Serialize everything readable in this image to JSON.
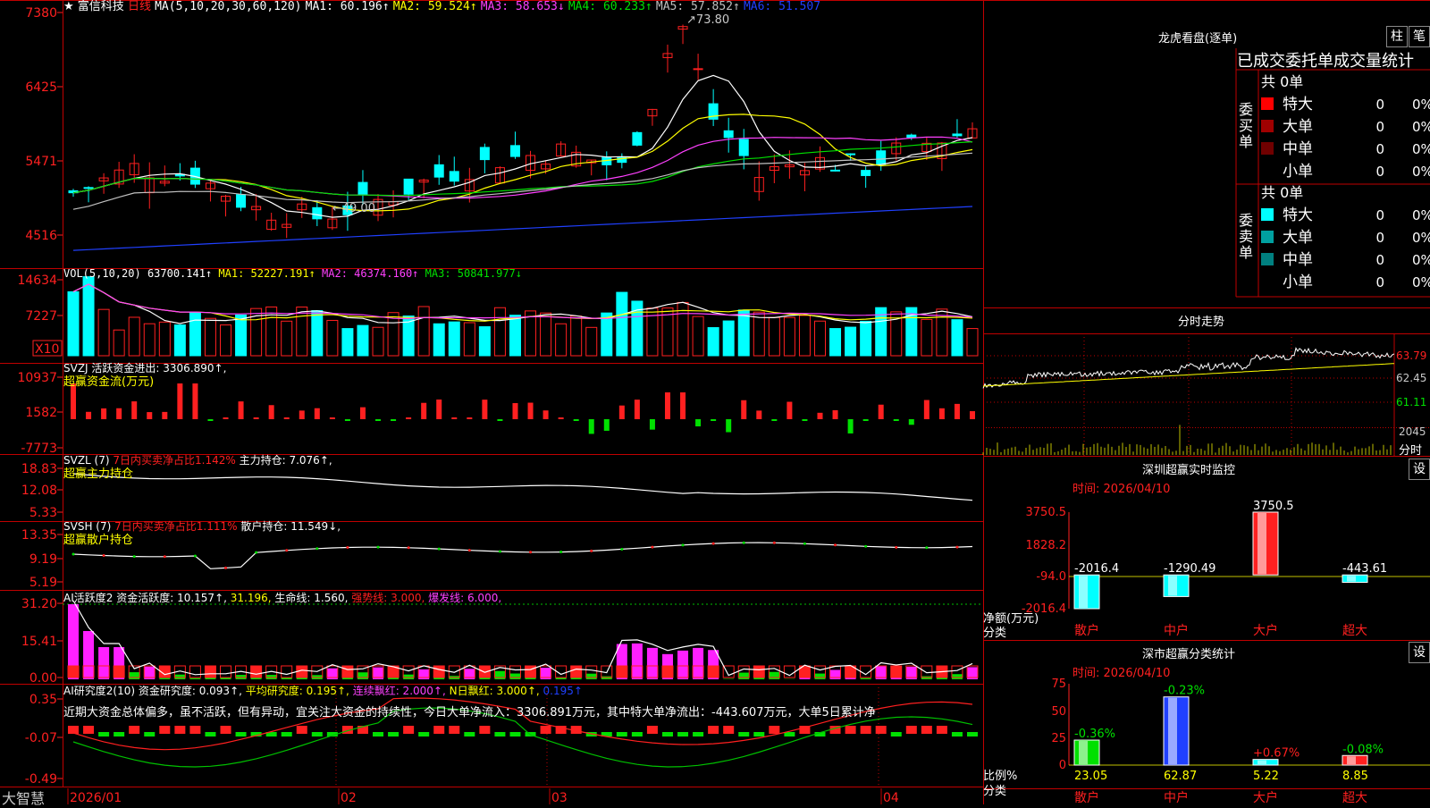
{
  "app": {
    "stock_name": "富信科技",
    "period": "日线",
    "watermark": "大智慧"
  },
  "price_panel": {
    "ma_header": "MA(5,10,20,30,60,120)",
    "ma_values": [
      {
        "label": "MA1: 60.196↑",
        "color": "#ffffff"
      },
      {
        "label": "MA2: 59.524↑",
        "color": "#ffff00"
      },
      {
        "label": "MA3: 58.653↓",
        "color": "#ff40ff"
      },
      {
        "label": "MA4: 60.233↑",
        "color": "#00e000"
      },
      {
        "label": "MA5: 57.852↑",
        "color": "#c0c0c0"
      },
      {
        "label": "MA6: 51.507",
        "color": "#2040ff"
      }
    ],
    "y_ticks": [
      "7380",
      "6425",
      "5471",
      "4516"
    ],
    "high_label": "73.80",
    "low_label": "49.00"
  },
  "vol_panel": {
    "header": "VOL(5,10,20)",
    "values": [
      {
        "label": "63700.141↑",
        "color": "#ffffff"
      },
      {
        "label": "MA1: 52227.191↑",
        "color": "#ffff00"
      },
      {
        "label": "MA2: 46374.160↑",
        "color": "#ff40ff"
      },
      {
        "label": "MA3: 50841.977↓",
        "color": "#00e000"
      }
    ],
    "y_ticks": [
      "14634",
      "7227"
    ],
    "multiplier": "X10"
  },
  "svzj_panel": {
    "header": "SVZJ",
    "value": "活跃资金进出: 3306.890↑,",
    "subtitle": "超赢资金流(万元)",
    "y_ticks": [
      "10937",
      "1582",
      "-7773"
    ]
  },
  "svzl_panel": {
    "header": "SVZL (7)",
    "red_text": "7日内买卖净占比1.142%",
    "value": "主力持仓: 7.076↑,",
    "subtitle": "超赢主力持仓",
    "y_ticks": [
      "18.83",
      "12.08",
      "5.33"
    ]
  },
  "svsh_panel": {
    "header": "SVSH (7)",
    "red_text": "7日内买卖净占比1.111%",
    "value": "散户持仓: 11.549↓,",
    "subtitle": "超赢散户持仓",
    "y_ticks": [
      "13.35",
      "9.19",
      "5.19"
    ]
  },
  "ai_active_panel": {
    "header": "AI活跃度2",
    "parts": [
      {
        "label": "资金活跃度: 10.157↑,",
        "color": "#ffffff"
      },
      {
        "label": "31.196,",
        "color": "#ffff00"
      },
      {
        "label": "生命线: 1.560,",
        "color": "#ffffff"
      },
      {
        "label": "强势线: 3.000,",
        "color": "#ff2020"
      },
      {
        "label": "爆发线: 6.000,",
        "color": "#ff40ff"
      }
    ],
    "y_ticks": [
      "31.20",
      "15.41",
      "0.00"
    ]
  },
  "ai_research_panel": {
    "header": "AI研究度2(10)",
    "parts": [
      {
        "label": "资金研究度: 0.093↑,",
        "color": "#ffffff"
      },
      {
        "label": "平均研究度: 0.195↑,",
        "color": "#ffff00"
      },
      {
        "label": "连续飘红: 2.000↑,",
        "color": "#ff40ff"
      },
      {
        "label": "N日飘红: 3.000↑,",
        "color": "#ffff00"
      },
      {
        "label": "0.195↑",
        "color": "#2040ff"
      }
    ],
    "commentary": "近期大资金总体偏多，虽不活跃，但有异动，宜关注大资金的持续性，今日大单净流入：3306.891万元，其中特大单净流出：-443.607万元，大单5日累计净",
    "y_ticks": [
      "0.35",
      "-0.07",
      "-0.49"
    ]
  },
  "date_axis": {
    "labels": [
      "2026/01",
      "02",
      "03",
      "04"
    ]
  },
  "dragon_tiger": {
    "title": "龙虎看盘(逐单)",
    "tab_bar": "柱",
    "tab_tick": "笔",
    "stats_header": "已成交委托单成交量统计",
    "buy_label": "委买单",
    "sell_label": "委卖单",
    "buy_total": "共 0单",
    "sell_total": "共 0单",
    "buy_rows": [
      {
        "label": "特大",
        "count": "0",
        "pct": "0%",
        "color": "#ff0000"
      },
      {
        "label": "大单",
        "count": "0",
        "pct": "0%",
        "color": "#a00000"
      },
      {
        "label": "中单",
        "count": "0",
        "pct": "0%",
        "color": "#700000"
      },
      {
        "label": "小单",
        "count": "0",
        "pct": "0%",
        "color": ""
      }
    ],
    "sell_rows": [
      {
        "label": "特大",
        "count": "0",
        "pct": "0%",
        "color": "#00ffff"
      },
      {
        "label": "大单",
        "count": "0",
        "pct": "0%",
        "color": "#00a0a0"
      },
      {
        "label": "中单",
        "count": "0",
        "pct": "0%",
        "color": "#008080"
      },
      {
        "label": "小单",
        "count": "0",
        "pct": "0%",
        "color": ""
      }
    ]
  },
  "intraday": {
    "title": "分时走势",
    "y_ticks": [
      "63.79",
      "62.45",
      "61.11"
    ],
    "vol_label": "2045",
    "vol_unit": "分时"
  },
  "sz_monitor": {
    "title": "深圳超赢实时监控",
    "settings": "设",
    "time_label": "时间: 2026/04/10",
    "y_ticks": [
      "3750.5",
      "1828.2",
      "-94.0",
      "-2016.4"
    ],
    "y_caption_1": "净额(万元)",
    "y_caption_2": "分类"
  },
  "sz_class": {
    "title": "深市超赢分类统计",
    "settings": "设",
    "time_label": "时间: 2026/04/10",
    "y_ticks": [
      "75",
      "50",
      "25",
      "0"
    ],
    "y_caption_1": "比例%",
    "y_caption_2": "分类"
  },
  "colors": {
    "up": "#ff2020",
    "down": "#00ffff",
    "grid": "#b00000",
    "vol_down": "#00ffff"
  },
  "chart_data": [
    {
      "type": "bar",
      "title": "深圳超赢实时监控",
      "ylabel": "净额(万元)",
      "categories": [
        "散户",
        "中户",
        "大户",
        "超大"
      ],
      "values": [
        -2016.4,
        -1290.49,
        3750.5,
        -443.61
      ],
      "value_labels": [
        "-2016.4",
        "-1290.49",
        "3750.5",
        "-443.61"
      ],
      "category_colors": [
        "#00ffff",
        "#00ffff",
        "#ff2020",
        "#00ffff"
      ],
      "ylim": [
        -2016.4,
        3750.5
      ]
    },
    {
      "type": "bar",
      "title": "深市超赢分类统计",
      "ylabel": "比例%",
      "categories": [
        "散户",
        "中户",
        "大户",
        "超大"
      ],
      "values": [
        23.05,
        62.87,
        5.22,
        8.85
      ],
      "changes": [
        "-0.36%",
        "-0.23%",
        "+0.67%",
        "-0.08%"
      ],
      "change_colors": [
        "#00e000",
        "#00e000",
        "#ff2020",
        "#00e000"
      ],
      "bar_colors": [
        "#00e000",
        "#2040ff",
        "#00ffff",
        "#ff2020"
      ],
      "ylim": [
        0,
        75
      ]
    }
  ]
}
